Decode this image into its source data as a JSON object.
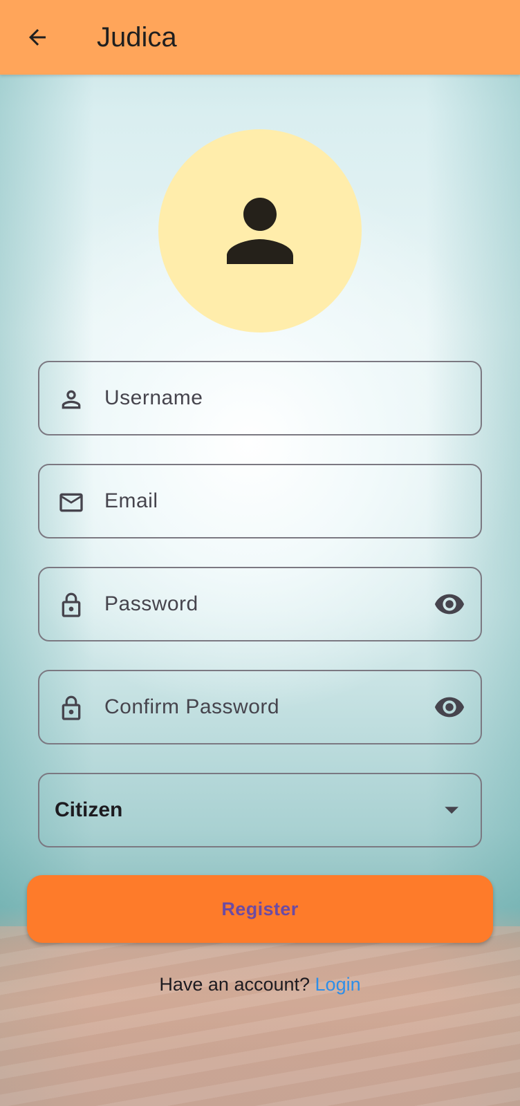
{
  "app_bar": {
    "title": "Judica",
    "back_icon": "arrow-back-icon",
    "background": "#ffa55a"
  },
  "avatar": {
    "icon": "person-icon",
    "background": "#ffedab"
  },
  "form": {
    "username": {
      "placeholder": "Username",
      "icon": "person-outline-icon"
    },
    "email": {
      "placeholder": "Email",
      "icon": "mail-icon"
    },
    "password": {
      "placeholder": "Password",
      "icon": "lock-icon",
      "toggle_icon": "eye-icon"
    },
    "confirm_password": {
      "placeholder": "Confirm Password",
      "icon": "lock-icon",
      "toggle_icon": "eye-icon"
    },
    "role": {
      "selected": "Citizen",
      "icon": "arrow-drop-down-icon"
    }
  },
  "register_button": {
    "label": "Register",
    "background": "#fe7b2a",
    "text_color": "#6c4ba3"
  },
  "footer": {
    "prompt": "Have an account? ",
    "link": "Login",
    "link_color": "#2e8ee8"
  }
}
